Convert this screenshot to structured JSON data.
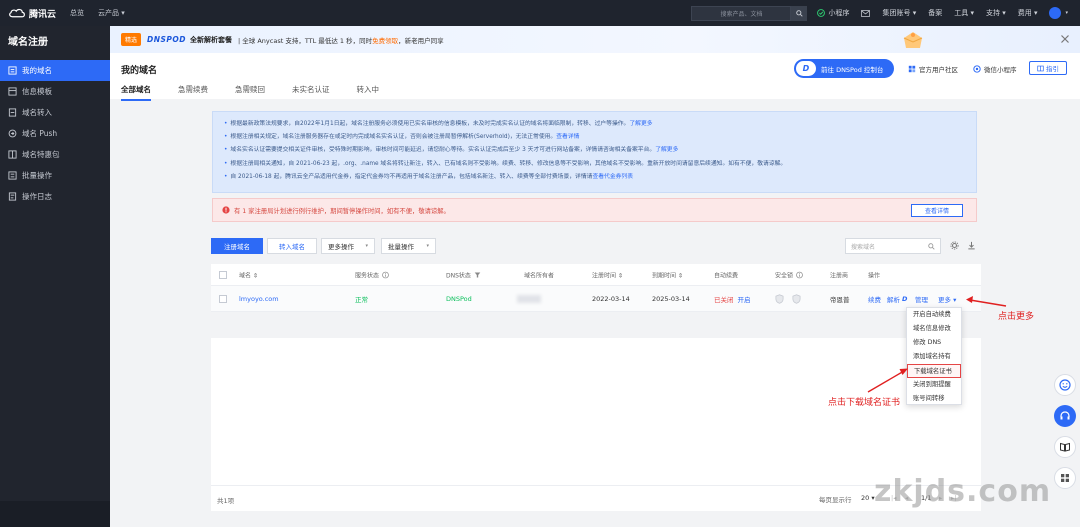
{
  "topbar": {
    "logo_text": "腾讯云",
    "nav": [
      "总览",
      "云产品 ▾"
    ],
    "search_placeholder": "搜索产品、文档",
    "items": [
      "小程序",
      "集团账号 ▾",
      "备案",
      "工具 ▾",
      "支持 ▾",
      "费用 ▾"
    ]
  },
  "sidebar": {
    "title": "域名注册",
    "items": [
      {
        "label": "我的域名",
        "icon": "list-icon"
      },
      {
        "label": "信息模板",
        "icon": "template-icon"
      },
      {
        "label": "域名转入",
        "icon": "transfer-icon"
      },
      {
        "label": "域名 Push",
        "icon": "push-icon"
      },
      {
        "label": "域名特惠包",
        "icon": "package-icon"
      },
      {
        "label": "批量操作",
        "icon": "batch-icon"
      },
      {
        "label": "操作日志",
        "icon": "log-icon"
      }
    ]
  },
  "banner": {
    "badge": "精选",
    "brand": "DNSPOD",
    "strong": "全新解析套餐",
    "text": "| 全球 Anycast 支持，TTL 最低达 1 秒，同时",
    "highlight": "免费领取",
    "text2": "，新老用户同享"
  },
  "page": {
    "title": "我的域名",
    "tabs": [
      "全部域名",
      "急需续费",
      "急需赎回",
      "未实名认证",
      "转入中"
    ],
    "dnspod_button": "前往 DNSPod 控制台",
    "dnspod_logo": "D",
    "links": [
      "官方用户社区",
      "微信小程序"
    ],
    "guide": "指引"
  },
  "notice": [
    {
      "text": "根据最新政策法规要求，自2022年1月1日起，域名注册服务必须使用已实名审核的信息模板，未及时完成实名认证的域名将面临限制，转移、过户等操作。",
      "link": "了解更多"
    },
    {
      "text": "根据注册相关规定，域名注册服务器存在或定时内完成域名实名认证，否则会被注册局暂停解析(Serverhold)，无法正常使用。",
      "link": "查看详情"
    },
    {
      "text": "域名实名认证需要提交相关证件审核，受特殊时期影响，审核时间可能延迟，请您耐心等待。实名认证完成后至少 3 天才可进行网站备案，详情请咨询相关备案平台。",
      "link": "了解更多"
    },
    {
      "text": "根据注册局相关通知，自 2021-06-23 起，.org、.name 域名将转让新注，转入、已有域名则不受影响。续费、转移、修改信息等不受影响，其他域名不受影响。重新开放时间请留意后续通知。如有不便，敬请谅解。",
      "link": ""
    },
    {
      "text": "自 2021-06-18 起，腾讯云全产品适用代金券，指定代金券均不再适用于域名注册产品，包括域名新注、转入、续费等全部付费场景，详情请",
      "link": "查看代金券列表"
    }
  ],
  "alert": {
    "text": "有 1 家注册局计划进行例行维护，期间暂停操作时间，如有不便，敬请谅解。",
    "button": "查看详情"
  },
  "toolbar": {
    "register": "注册域名",
    "transfer": "转入域名",
    "more_ops": "更多操作",
    "batch_ops": "批量操作",
    "search_placeholder": "搜索域名"
  },
  "table": {
    "headers": [
      "域名 ⇕",
      "服务状态",
      "DNS状态",
      "域名所有者",
      "注册时间 ⇕",
      "到期时间 ⇕",
      "自动续费",
      "安全锁",
      "注册商",
      "操作"
    ],
    "rows": [
      {
        "domain": "lmyoyo.com",
        "status": "正常",
        "dns": "DNSPod",
        "register_date": "2022-03-14",
        "expire_date": "2025-03-14",
        "auto_renew": "已关闭",
        "auto_renew_action": "开启",
        "registrar": "帝恩普",
        "actions": [
          "续费",
          "解析",
          "管理",
          "更多 ▾"
        ]
      }
    ],
    "total": "共1项",
    "page_size_label": "每页显示行",
    "page_size": "20",
    "page_info": "1/1"
  },
  "more_menu": {
    "items": [
      "开启自动续费",
      "域名信息修改",
      "修改 DNS",
      "添加域名持有",
      "下载域名证书",
      "关闭到期提醒",
      "账号间转移"
    ],
    "highlighted_index": 4
  },
  "annotations": {
    "click_more": "点击更多",
    "click_download": "点击下载域名证书"
  },
  "watermark": "zkjds.com",
  "colors": {
    "primary": "#2d6af6",
    "topbar": "#1f242e",
    "sidebar": "#21252e",
    "annotation": "#e02020"
  }
}
